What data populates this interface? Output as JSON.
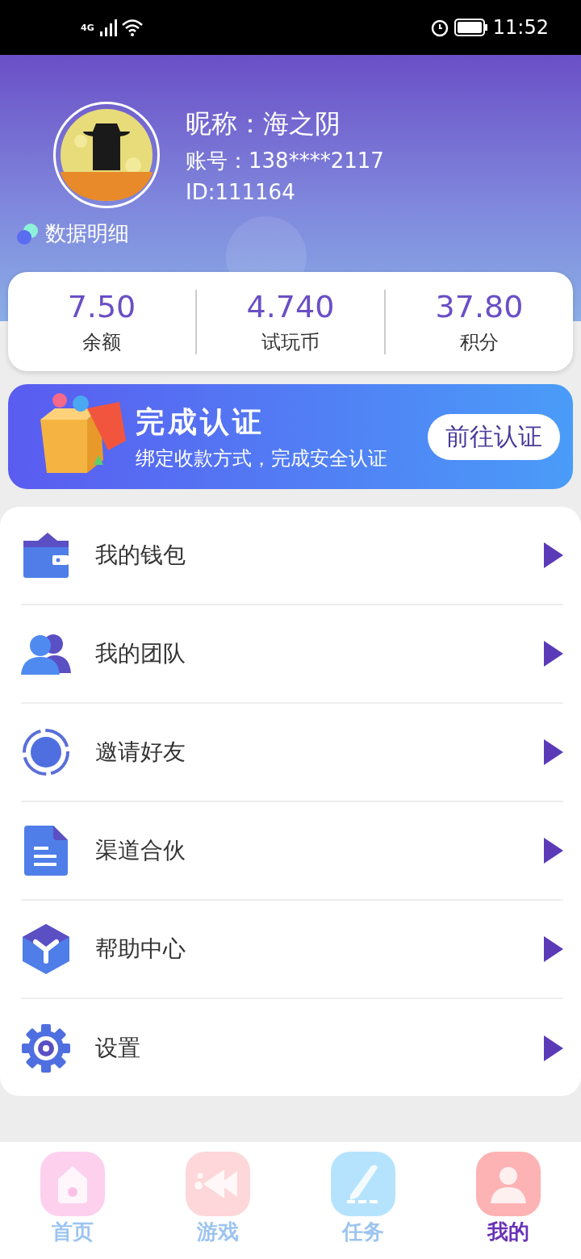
{
  "status_bar": {
    "time": "11:52",
    "network": "4G"
  },
  "profile": {
    "nickname": "昵称：海之阴",
    "account": "账号：138****2117",
    "id": "ID:111164",
    "details_link": "数据明细"
  },
  "stats": [
    {
      "value": "7.50",
      "label": "余额"
    },
    {
      "value": "4.740",
      "label": "试玩币"
    },
    {
      "value": "37.80",
      "label": "积分"
    }
  ],
  "banner": {
    "title": "完成认证",
    "subtitle": "绑定收款方式，完成安全认证",
    "button": "前往认证"
  },
  "menu": [
    {
      "kind": "wallet",
      "label": "我的钱包"
    },
    {
      "kind": "team",
      "label": "我的团队"
    },
    {
      "kind": "invite",
      "label": "邀请好友"
    },
    {
      "kind": "partner",
      "label": "渠道合伙"
    },
    {
      "kind": "help",
      "label": "帮助中心"
    },
    {
      "kind": "settings",
      "label": "设置"
    }
  ],
  "tabs": [
    {
      "kind": "home",
      "label": "首页",
      "color": "#fdd0ee",
      "selected": false
    },
    {
      "kind": "games",
      "label": "游戏",
      "color": "#fdd7d9",
      "selected": false
    },
    {
      "kind": "tasks",
      "label": "任务",
      "color": "#b5e3fd",
      "selected": false
    },
    {
      "kind": "me",
      "label": "我的",
      "color": "#fdb2b4",
      "selected": true
    }
  ]
}
